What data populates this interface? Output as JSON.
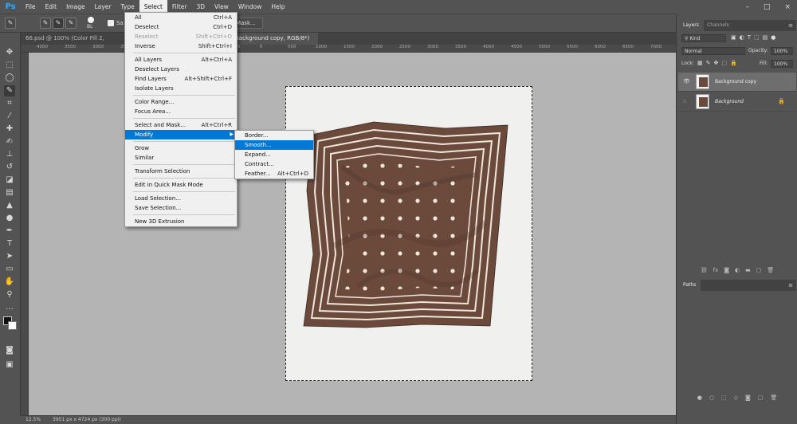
{
  "app": {
    "logo": "Ps"
  },
  "menubar": [
    "File",
    "Edit",
    "Image",
    "Layer",
    "Type",
    "Select",
    "Filter",
    "3D",
    "View",
    "Window",
    "Help"
  ],
  "options": {
    "brush_size": "BL",
    "sample_label": "Sa",
    "mask_label": "t Mask..."
  },
  "tabs": [
    {
      "label": "66.psd @ 100% (Color Fill 2, RGB/8#)",
      "close": "×"
    },
    {
      "label": "Background copy, RGB/8*) *",
      "close": "×"
    }
  ],
  "ruler": [
    "4000",
    "3500",
    "3000",
    "2500",
    "2000",
    "1500",
    "1000",
    "500",
    "0",
    "500",
    "1000",
    "1500",
    "2000",
    "2500",
    "3000",
    "3500",
    "4000",
    "4500",
    "5000",
    "5500",
    "6000",
    "6500",
    "7000"
  ],
  "select_menu": [
    {
      "label": "All",
      "shortcut": "Ctrl+A"
    },
    {
      "label": "Deselect",
      "shortcut": "Ctrl+D"
    },
    {
      "label": "Reselect",
      "shortcut": "Shift+Ctrl+D",
      "disabled": true
    },
    {
      "label": "Inverse",
      "shortcut": "Shift+Ctrl+I"
    },
    {
      "sep": true
    },
    {
      "label": "All Layers",
      "shortcut": "Alt+Ctrl+A"
    },
    {
      "label": "Deselect Layers",
      "shortcut": ""
    },
    {
      "label": "Find Layers",
      "shortcut": "Alt+Shift+Ctrl+F"
    },
    {
      "label": "Isolate Layers",
      "shortcut": ""
    },
    {
      "sep": true
    },
    {
      "label": "Color Range...",
      "shortcut": ""
    },
    {
      "label": "Focus Area...",
      "shortcut": ""
    },
    {
      "sep": true
    },
    {
      "label": "Select and Mask...",
      "shortcut": "Alt+Ctrl+R"
    },
    {
      "label": "Modify",
      "shortcut": "",
      "submenu": true,
      "highlighted": true
    },
    {
      "sep": true
    },
    {
      "label": "Grow",
      "shortcut": ""
    },
    {
      "label": "Similar",
      "shortcut": ""
    },
    {
      "sep": true
    },
    {
      "label": "Transform Selection",
      "shortcut": ""
    },
    {
      "sep": true
    },
    {
      "label": "Edit in Quick Mask Mode",
      "shortcut": ""
    },
    {
      "sep": true
    },
    {
      "label": "Load Selection...",
      "shortcut": ""
    },
    {
      "label": "Save Selection...",
      "shortcut": ""
    },
    {
      "sep": true
    },
    {
      "label": "New 3D Extrusion",
      "shortcut": ""
    }
  ],
  "modify_menu": [
    {
      "label": "Border...",
      "shortcut": ""
    },
    {
      "label": "Smooth...",
      "shortcut": "",
      "highlighted": true
    },
    {
      "label": "Expand...",
      "shortcut": ""
    },
    {
      "label": "Contract...",
      "shortcut": ""
    },
    {
      "label": "Feather...",
      "shortcut": "Alt+Ctrl+D"
    }
  ],
  "layers_panel": {
    "tabs": [
      "Layers",
      "Channels"
    ],
    "filter": "Kind",
    "blend_mode": "Normal",
    "opacity_label": "Opacity:",
    "opacity": "100%",
    "lock_label": "Lock:",
    "fill_label": "Fill:",
    "fill": "100%",
    "layers": [
      {
        "name": "Background copy",
        "selected": true
      },
      {
        "name": "Background",
        "locked": true
      }
    ]
  },
  "paths_panel": {
    "title": "Paths"
  },
  "status": {
    "zoom": "12.5%",
    "doc": "3951 px x 4724 px (300 ppi)"
  },
  "colors": {
    "scarf": "#6b4a3c",
    "menu_highlight": "#0078d7",
    "ps_blue": "#31a8ff"
  }
}
